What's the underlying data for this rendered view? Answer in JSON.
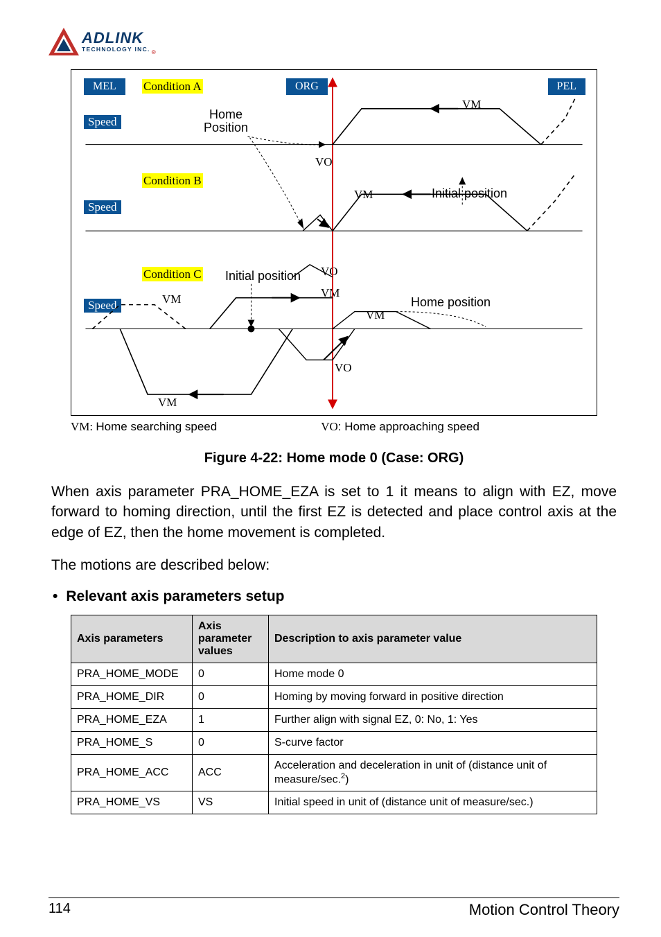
{
  "logo": {
    "main": "ADLINK",
    "sub": "TECHNOLOGY INC."
  },
  "diagram": {
    "mel": "MEL",
    "org": "ORG",
    "pel": "PEL",
    "condA": "Condition A",
    "condB": "Condition B",
    "condC": "Condition C",
    "speed": "Speed",
    "home_position": "Home",
    "home_position2": "Position",
    "initial_position": "Initial position",
    "home_position_lbl": "Home position",
    "vo": "VO",
    "vm": "VM"
  },
  "legend": {
    "vm": "VM: ",
    "vm_desc": "Home searching speed",
    "vo": "VO",
    "vo_desc": ": Home approaching speed"
  },
  "caption": "Figure 4-22: Home mode 0 (Case:  ORG)",
  "para1": "When axis parameter PRA_HOME_EZA is set to 1 it means to align with EZ, move forward to homing direction, until the first EZ is detected and place control axis at the edge of EZ, then the home movement is completed.",
  "para2": "The motions are described below:",
  "bullet": "Relevant axis parameters setup",
  "table": {
    "headers": [
      "Axis parameters",
      "Axis parameter values",
      "Description to axis parameter value"
    ],
    "rows": [
      {
        "p": "PRA_HOME_MODE",
        "v": "0",
        "d": "Home mode 0"
      },
      {
        "p": "PRA_HOME_DIR",
        "v": "0",
        "d": "Homing by moving forward in positive direction"
      },
      {
        "p": "PRA_HOME_EZA",
        "v": "1",
        "d": "Further align with signal EZ, 0: No, 1: Yes"
      },
      {
        "p": "PRA_HOME_S",
        "v": "0",
        "d": "S-curve factor"
      },
      {
        "p": "PRA_HOME_ACC",
        "v": "ACC",
        "d": "Acceleration and deceleration in unit of (distance unit of measure/sec.",
        "sup": "2",
        "d2": ")"
      },
      {
        "p": "PRA_HOME_VS",
        "v": "VS",
        "d": "Initial speed in unit of (distance unit of measure/sec.)"
      }
    ]
  },
  "footer": {
    "page": "114",
    "section": "Motion Control Theory"
  }
}
